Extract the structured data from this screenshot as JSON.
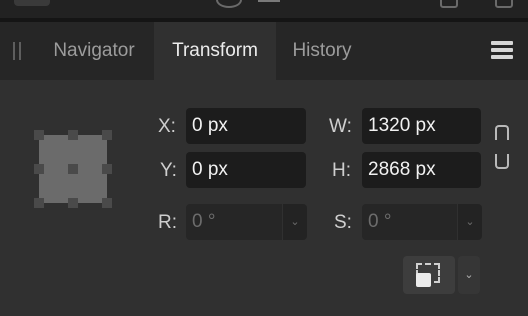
{
  "tabs": [
    {
      "label": "Navigator",
      "active": false
    },
    {
      "label": "Transform",
      "active": true
    },
    {
      "label": "History",
      "active": false
    }
  ],
  "transform": {
    "x": {
      "label": "X:",
      "value": "0 px"
    },
    "y": {
      "label": "Y:",
      "value": "0 px"
    },
    "w": {
      "label": "W:",
      "value": "1320 px"
    },
    "h": {
      "label": "H:",
      "value": "2868 px"
    },
    "r": {
      "label": "R:",
      "value": "0 °"
    },
    "s": {
      "label": "S:",
      "value": "0 °"
    }
  },
  "icons": {
    "dropdown": "⌄",
    "menu": "hamburger-icon",
    "link": "link-icon",
    "grip": "panel-grip-icon",
    "anchor": "anchor-selector-icon",
    "transform_origin": "dashed-square-icon"
  },
  "colors": {
    "panel_bg": "#303030",
    "tabbar_bg": "#262626",
    "field_bg": "#1c1c1c",
    "text": "#d8d8d8"
  }
}
